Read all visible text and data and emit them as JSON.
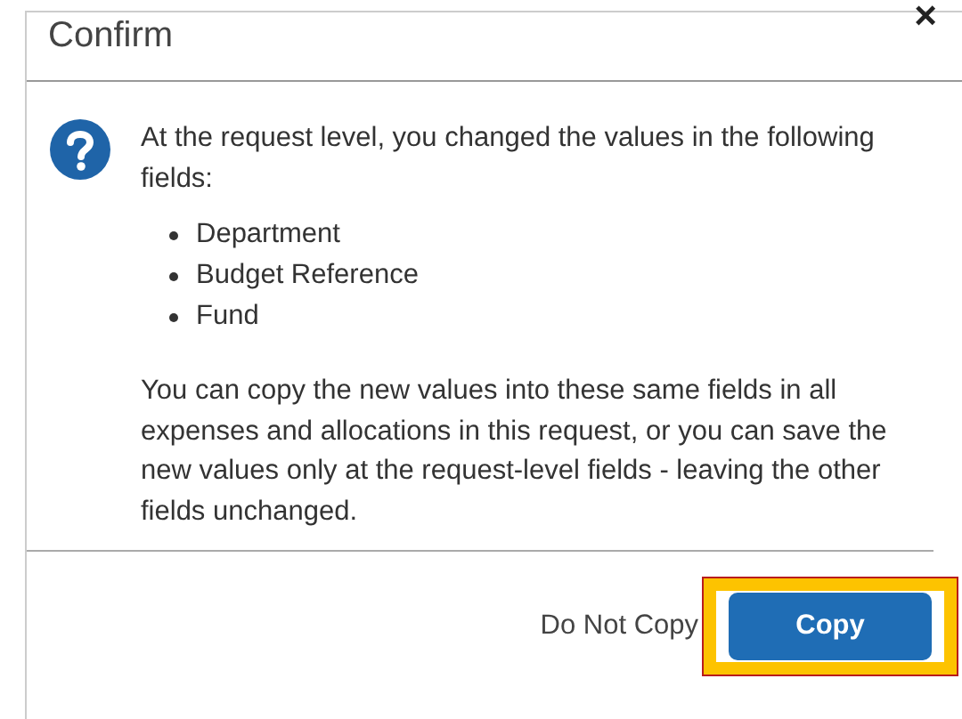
{
  "dialog": {
    "title": "Confirm",
    "close": "×"
  },
  "message": {
    "intro": "At the request level, you changed the values in the following fields:",
    "fields": [
      "Department",
      "Budget Reference",
      "Fund"
    ],
    "detail": "You can copy the new values into these same fields in all expenses and allocations in this request, or you can save the new values only at the request-level fields - leaving the other fields unchanged."
  },
  "buttons": [
    {
      "label": "Do Not Copy",
      "kind": "link",
      "highlighted": false
    },
    {
      "label": "Copy",
      "kind": "primary",
      "highlighted": true
    }
  ]
}
